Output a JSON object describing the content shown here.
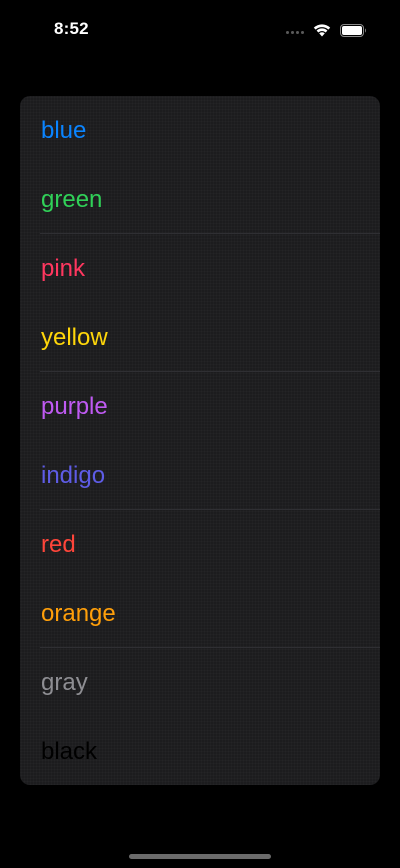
{
  "status_bar": {
    "time": "8:52",
    "icons": [
      "cellular-dots-icon",
      "wifi-icon",
      "battery-icon"
    ]
  },
  "list": {
    "items": [
      {
        "label": "blue",
        "color": "#0a84ff"
      },
      {
        "label": "green",
        "color": "#30d158"
      },
      {
        "label": "pink",
        "color": "#ff375f"
      },
      {
        "label": "yellow",
        "color": "#ffd60a"
      },
      {
        "label": "purple",
        "color": "#bf5af2"
      },
      {
        "label": "indigo",
        "color": "#5e5ce6"
      },
      {
        "label": "red",
        "color": "#ff453a"
      },
      {
        "label": "orange",
        "color": "#ff9f0a"
      },
      {
        "label": "gray",
        "color": "#8e8e93"
      },
      {
        "label": "black",
        "color": "#000000"
      }
    ]
  },
  "theme": {
    "background": "#000000",
    "card_background": "#1c1c1e",
    "separator": "#2f2f33"
  }
}
